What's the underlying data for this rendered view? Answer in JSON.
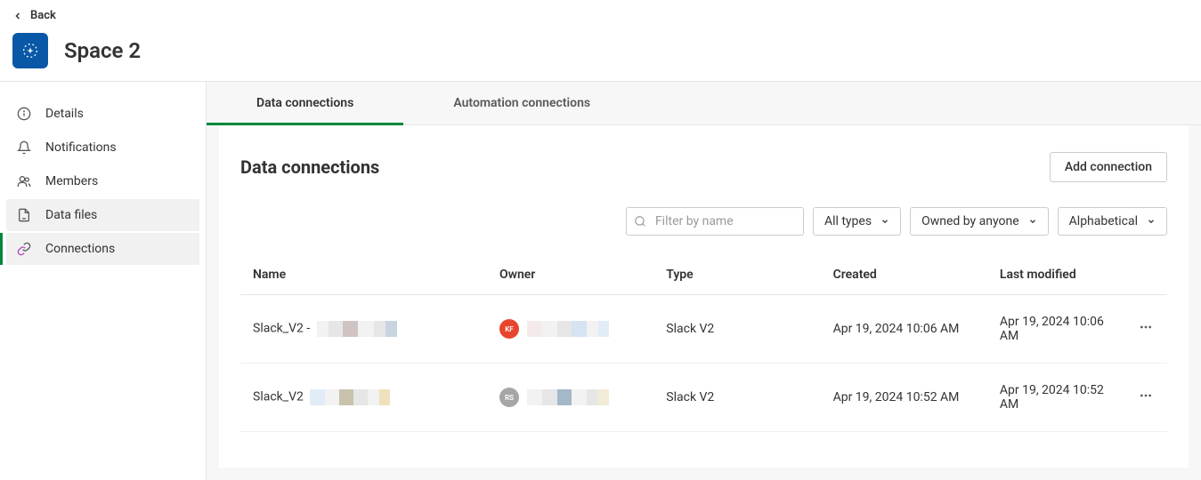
{
  "header": {
    "back_label": "Back",
    "space_title": "Space 2"
  },
  "sidebar": {
    "items": [
      {
        "label": "Details",
        "icon": "info-icon",
        "active": false
      },
      {
        "label": "Notifications",
        "icon": "bell-icon",
        "active": false
      },
      {
        "label": "Members",
        "icon": "members-icon",
        "active": false
      },
      {
        "label": "Data files",
        "icon": "file-icon",
        "active": false,
        "hover": true
      },
      {
        "label": "Connections",
        "icon": "connections-icon",
        "active": true
      }
    ]
  },
  "tabs": [
    {
      "label": "Data connections",
      "active": true
    },
    {
      "label": "Automation connections",
      "active": false
    }
  ],
  "panel": {
    "title": "Data connections",
    "add_button": "Add connection",
    "search_placeholder": "Filter by name",
    "filter_type": "All types",
    "filter_owner": "Owned by anyone",
    "sort": "Alphabetical"
  },
  "table": {
    "columns": [
      "Name",
      "Owner",
      "Type",
      "Created",
      "Last modified"
    ],
    "rows": [
      {
        "name": "Slack_V2 -",
        "owner_initials": "KF",
        "owner_color": "red",
        "type": "Slack V2",
        "created": "Apr 19, 2024 10:06 AM",
        "modified": "Apr 19, 2024 10:06 AM"
      },
      {
        "name": "Slack_V2",
        "owner_initials": "RS",
        "owner_color": "grey",
        "type": "Slack V2",
        "created": "Apr 19, 2024 10:52 AM",
        "modified": "Apr 19, 2024 10:52 AM"
      }
    ]
  }
}
